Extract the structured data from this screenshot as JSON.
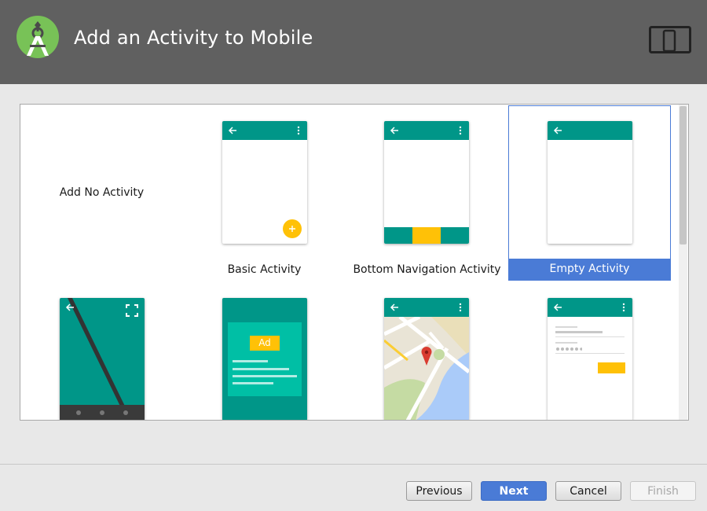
{
  "header": {
    "title": "Add an Activity to Mobile",
    "logo_icon": "android-studio-icon",
    "device_icon": "phone-tablet-icon"
  },
  "activities": [
    {
      "label": "Add No Activity",
      "preview": "none"
    },
    {
      "label": "Basic Activity",
      "preview": "basic"
    },
    {
      "label": "Bottom Navigation Activity",
      "preview": "bottom-nav"
    },
    {
      "label": "Empty Activity",
      "preview": "empty",
      "selected": true
    },
    {
      "label": "",
      "preview": "fullscreen"
    },
    {
      "label": "",
      "preview": "admob",
      "ad_badge": "Ad"
    },
    {
      "label": "",
      "preview": "maps"
    },
    {
      "label": "",
      "preview": "login"
    }
  ],
  "buttons": {
    "previous": "Previous",
    "next": "Next",
    "cancel": "Cancel",
    "finish": "Finish"
  },
  "colors": {
    "header_bg": "#606060",
    "teal": "#009688",
    "amber": "#ffc107",
    "selection": "#4a7bd6"
  }
}
